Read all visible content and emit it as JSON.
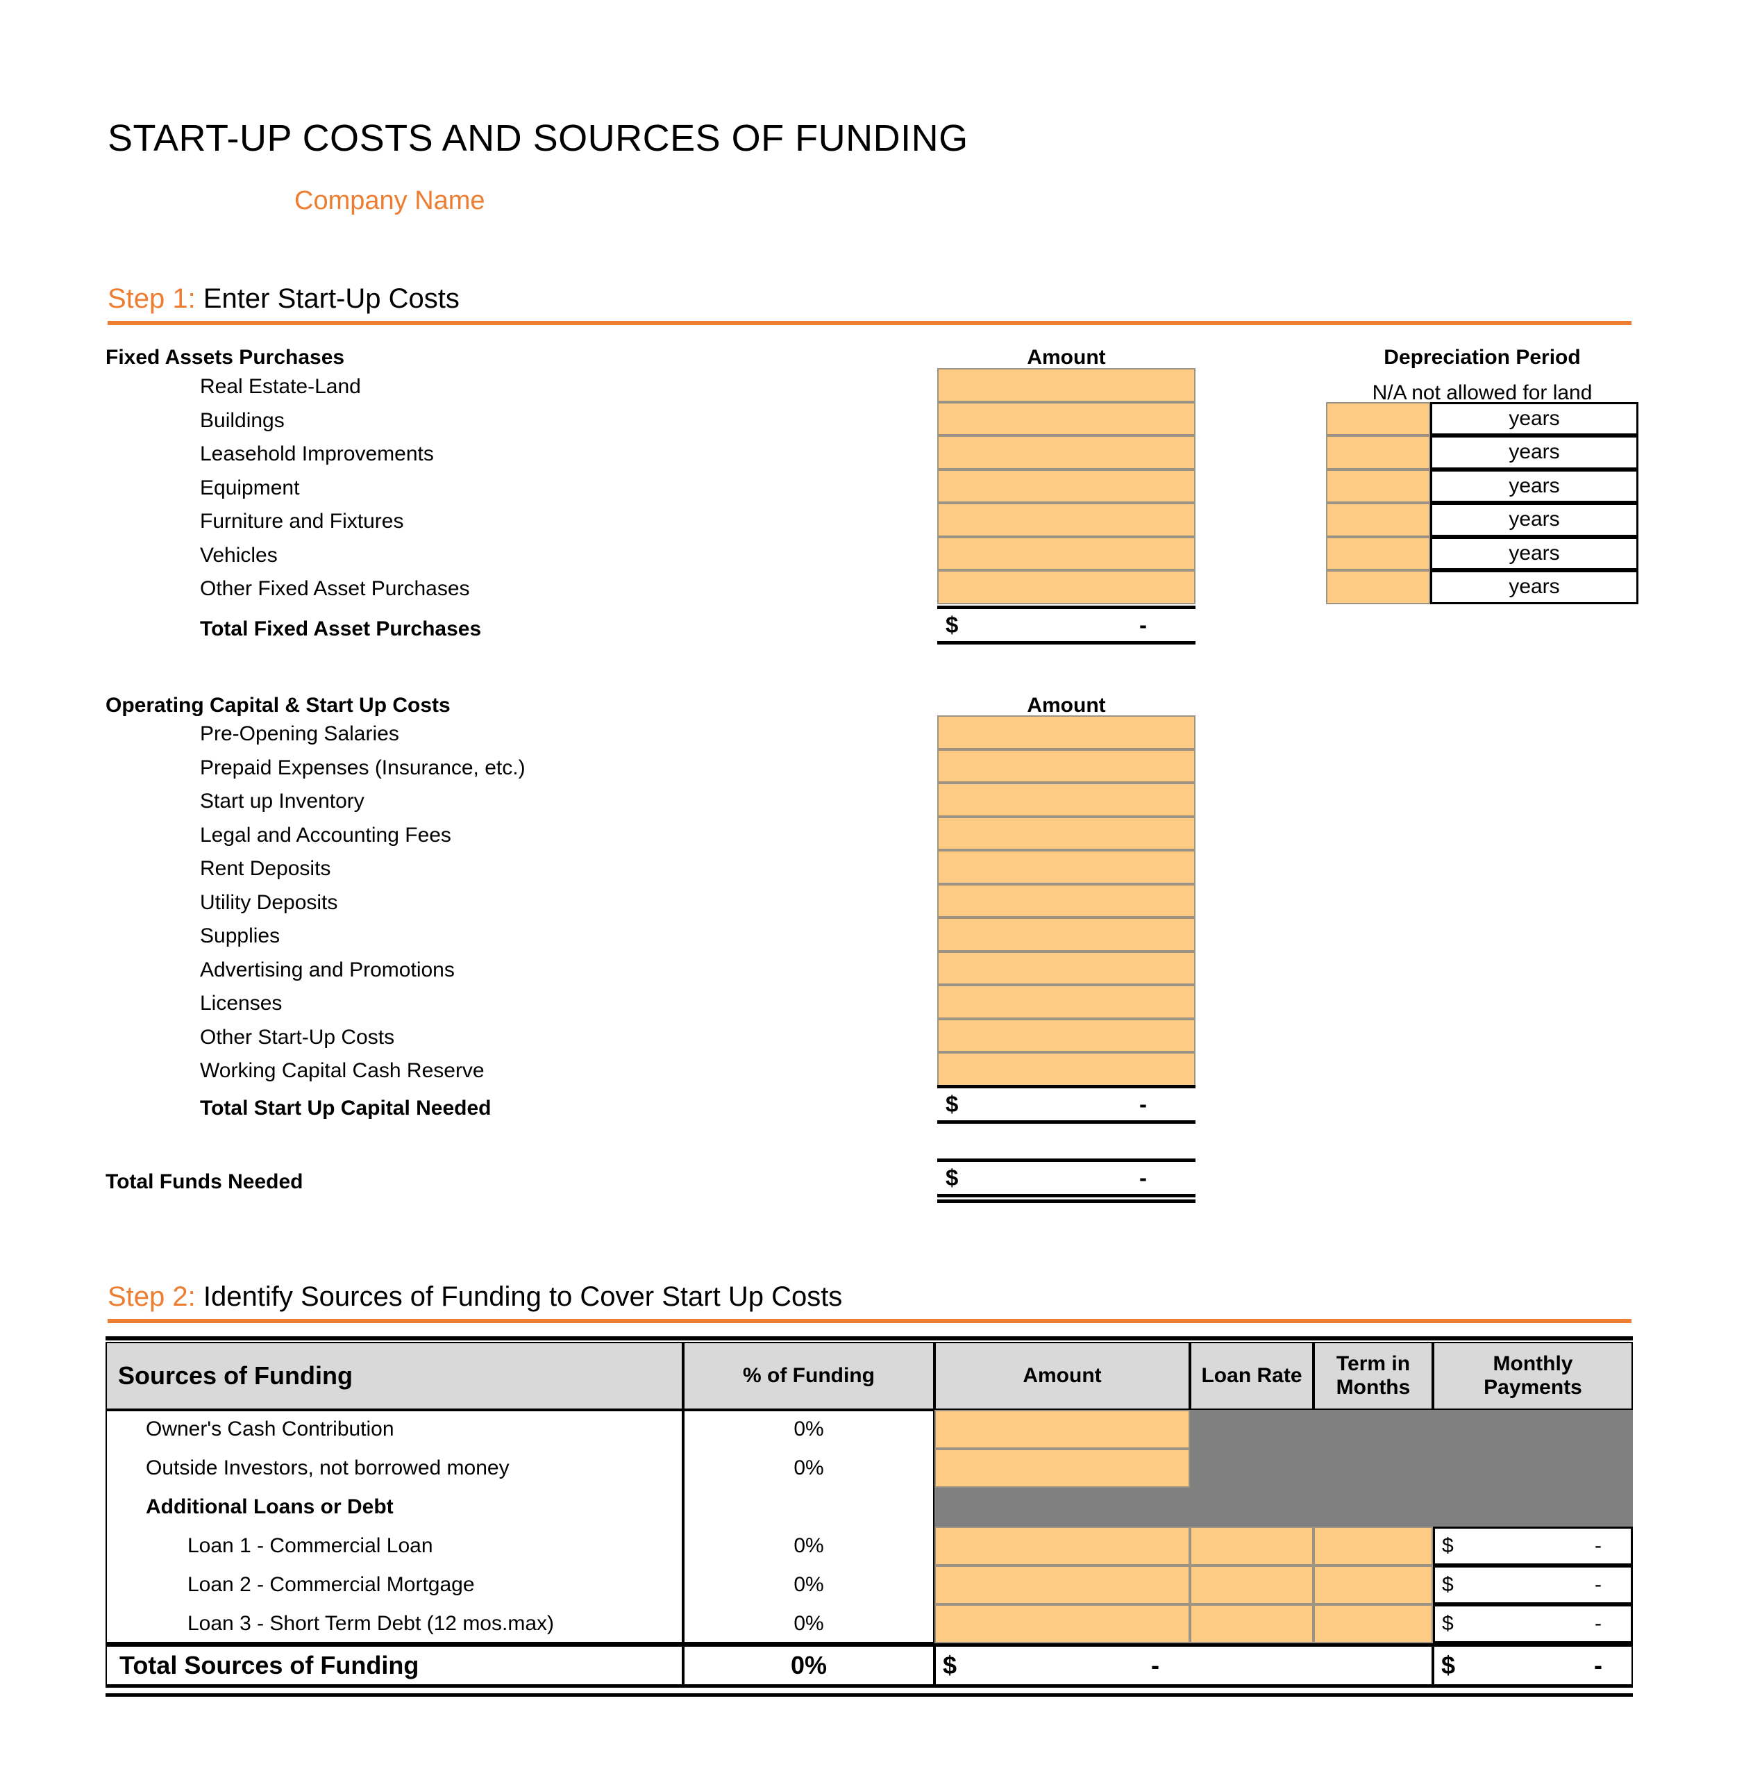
{
  "document": {
    "title": "START-UP COSTS AND SOURCES OF FUNDING",
    "company_name": "Company Name"
  },
  "theme": {
    "accent": "#ED7D31",
    "input_fill": "#FDCB83",
    "blocked_fill": "#808080",
    "header_fill": "#D9D9D9"
  },
  "step1": {
    "tag": "Step 1:",
    "title": " Enter Start-Up Costs",
    "fixed_assets": {
      "section_label": "Fixed Assets Purchases",
      "amount_header": "Amount",
      "depreciation_header": "Depreciation Period",
      "depreciation_note": "N/A not allowed for land",
      "years_unit": "years",
      "rows": [
        {
          "label": "Real Estate-Land",
          "amount": "",
          "depreciation": "",
          "has_years": false
        },
        {
          "label": "Buildings",
          "amount": "",
          "depreciation": "",
          "has_years": true
        },
        {
          "label": "Leasehold Improvements",
          "amount": "",
          "depreciation": "",
          "has_years": true
        },
        {
          "label": "Equipment",
          "amount": "",
          "depreciation": "",
          "has_years": true
        },
        {
          "label": "Furniture and Fixtures",
          "amount": "",
          "depreciation": "",
          "has_years": true
        },
        {
          "label": "Vehicles",
          "amount": "",
          "depreciation": "",
          "has_years": true
        },
        {
          "label": "Other Fixed Asset Purchases",
          "amount": "",
          "depreciation": "",
          "has_years": true
        }
      ],
      "total_label": "Total Fixed Asset Purchases",
      "total_currency": "$",
      "total_value": "-"
    },
    "operating_capital": {
      "section_label": "Operating Capital & Start Up Costs",
      "amount_header": "Amount",
      "rows": [
        {
          "label": "Pre-Opening Salaries",
          "amount": ""
        },
        {
          "label": "Prepaid Expenses (Insurance, etc.)",
          "amount": ""
        },
        {
          "label": "Start up Inventory",
          "amount": ""
        },
        {
          "label": "Legal and Accounting Fees",
          "amount": ""
        },
        {
          "label": "Rent Deposits",
          "amount": ""
        },
        {
          "label": "Utility Deposits",
          "amount": ""
        },
        {
          "label": "Supplies",
          "amount": ""
        },
        {
          "label": "Advertising and Promotions",
          "amount": ""
        },
        {
          "label": "Licenses",
          "amount": ""
        },
        {
          "label": "Other Start-Up Costs",
          "amount": ""
        },
        {
          "label": "Working Capital Cash Reserve",
          "amount": ""
        }
      ],
      "total_label": "Total Start Up Capital Needed",
      "total_currency": "$",
      "total_value": "-"
    },
    "grand_total": {
      "label": "Total Funds Needed",
      "currency": "$",
      "value": "-"
    }
  },
  "step2": {
    "tag": "Step 2:",
    "title": " Identify Sources of Funding to Cover Start Up Costs",
    "table": {
      "columns": [
        {
          "key": "source",
          "label": "Sources of Funding"
        },
        {
          "key": "percent",
          "label": "% of Funding"
        },
        {
          "key": "amount",
          "label": "Amount"
        },
        {
          "key": "rate",
          "label": "Loan Rate"
        },
        {
          "key": "term",
          "label": "Term in\nMonths",
          "line1": "Term in",
          "line2": "Months"
        },
        {
          "key": "payment",
          "label": "Monthly\nPayments",
          "line1": "Monthly",
          "line2": "Payments"
        }
      ],
      "rows": [
        {
          "source": "Owner's Cash Contribution",
          "percent": "0%",
          "amount": "",
          "amount_style": "input",
          "rate": "",
          "rate_style": "blocked",
          "term": "",
          "term_style": "blocked",
          "payment": "",
          "payment_style": "blocked",
          "indent": 1,
          "bold": false
        },
        {
          "source": "Outside Investors, not borrowed money",
          "percent": "0%",
          "amount": "",
          "amount_style": "input",
          "rate": "",
          "rate_style": "blocked",
          "term": "",
          "term_style": "blocked",
          "payment": "",
          "payment_style": "blocked",
          "indent": 1,
          "bold": false
        },
        {
          "source": "Additional Loans or Debt",
          "percent": "",
          "amount": "",
          "amount_style": "blocked",
          "rate": "",
          "rate_style": "blocked",
          "term": "",
          "term_style": "blocked",
          "payment": "",
          "payment_style": "blocked",
          "indent": 1,
          "bold": true
        },
        {
          "source": "Loan 1 - Commercial Loan",
          "percent": "0%",
          "amount": "",
          "amount_style": "input",
          "rate": "",
          "rate_style": "input",
          "term": "",
          "term_style": "input",
          "payment_currency": "$",
          "payment_value": "-",
          "payment_style": "money",
          "indent": 2,
          "bold": false
        },
        {
          "source": "Loan 2 - Commercial Mortgage",
          "percent": "0%",
          "amount": "",
          "amount_style": "input",
          "rate": "",
          "rate_style": "input",
          "term": "",
          "term_style": "input",
          "payment_currency": "$",
          "payment_value": "-",
          "payment_style": "money",
          "indent": 2,
          "bold": false
        },
        {
          "source": "Loan 3 - Short Term Debt (12 mos.max)",
          "percent": "0%",
          "amount": "",
          "amount_style": "input",
          "rate": "",
          "rate_style": "input",
          "term": "",
          "term_style": "input",
          "payment_currency": "$",
          "payment_value": "-",
          "payment_style": "money",
          "indent": 2,
          "bold": false
        }
      ],
      "total_row": {
        "source": "Total Sources of Funding",
        "percent": "0%",
        "amount_currency": "$",
        "amount_value": "-",
        "payment_currency": "$",
        "payment_value": "-"
      }
    }
  }
}
